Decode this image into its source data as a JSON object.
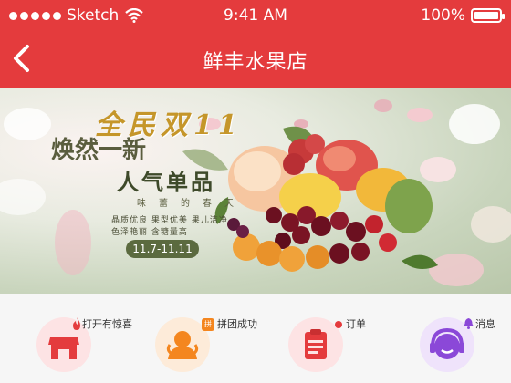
{
  "status_bar": {
    "carrier": "Sketch",
    "time": "9:41 AM",
    "battery": "100%"
  },
  "nav": {
    "title": "鲜丰水果店"
  },
  "banner": {
    "headline": "全民双11",
    "line2": "焕然一新",
    "line3": "人气单品",
    "subline": "味蕾的春天",
    "features_1": "晶质优良 果型优美 果儿洁净",
    "features_2": "色泽艳丽 含糖量高",
    "date_range": "11.7-11.11"
  },
  "menu": [
    {
      "label": "打开有惊喜",
      "icon": "store-icon",
      "badge_icon": "flame-icon"
    },
    {
      "label": "拼团成功",
      "icon": "group-person-icon",
      "badge_icon": "pin-badge-icon",
      "badge_text": "拼"
    },
    {
      "label": "订单",
      "icon": "order-list-icon",
      "badge_icon": "dot-badge-icon"
    },
    {
      "label": "消息",
      "icon": "headset-icon",
      "badge_icon": "bell-icon"
    }
  ],
  "colors": {
    "header": "#e43b3d",
    "menu_bg": "#f6f6f6"
  }
}
